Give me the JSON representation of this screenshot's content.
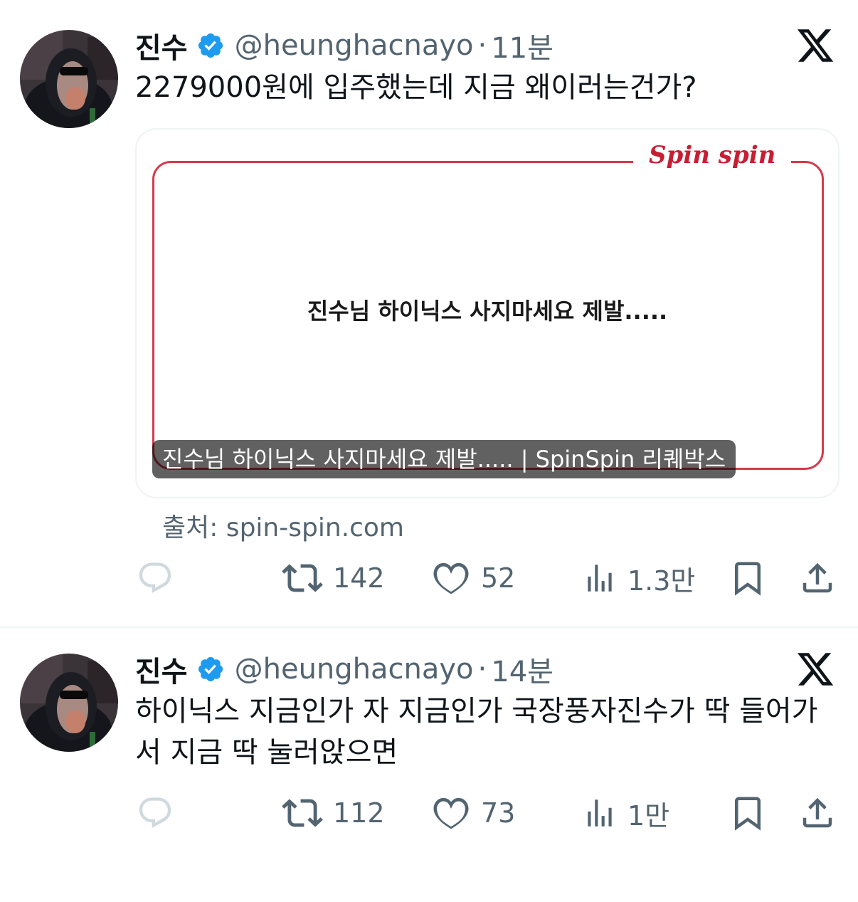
{
  "tweets": [
    {
      "author": {
        "display_name": "진수",
        "handle": "@heunghacnayo",
        "verified": true
      },
      "separator": "·",
      "time": "11분",
      "text": "2279000원에 입주했는데 지금 왜이러는건가?",
      "card": {
        "brand": "Spin spin",
        "message": "진수님 하이닉스 사지마세요 제발.....",
        "caption": "진수님 하이닉스 사지마세요 제발..... | SpinSpin 리퀘박스",
        "frame_color": "#d63a4a"
      },
      "source": "출처: spin-spin.com",
      "stats": {
        "retweets": "142",
        "likes": "52",
        "views": "1.3만"
      }
    },
    {
      "author": {
        "display_name": "진수",
        "handle": "@heunghacnayo",
        "verified": true
      },
      "separator": "·",
      "time": "14분",
      "text": "하이닉스 지금인가 자 지금인가 국장풍자진수가 딱 들어가서 지금 딱 눌러앉으면",
      "stats": {
        "retweets": "112",
        "likes": "73",
        "views": "1만"
      }
    }
  ],
  "icons": {
    "reply": "reply-icon",
    "retweet": "retweet-icon",
    "like": "heart-icon",
    "views": "views-icon",
    "bookmark": "bookmark-icon",
    "share": "share-icon",
    "verified": "verified-badge-icon",
    "platform": "x-logo-icon"
  },
  "colors": {
    "text_primary": "#0f1419",
    "text_secondary": "#536471",
    "verified_blue": "#1d9bf0",
    "reply_icon": "#cfd9de",
    "brand_red": "#c81e33"
  }
}
